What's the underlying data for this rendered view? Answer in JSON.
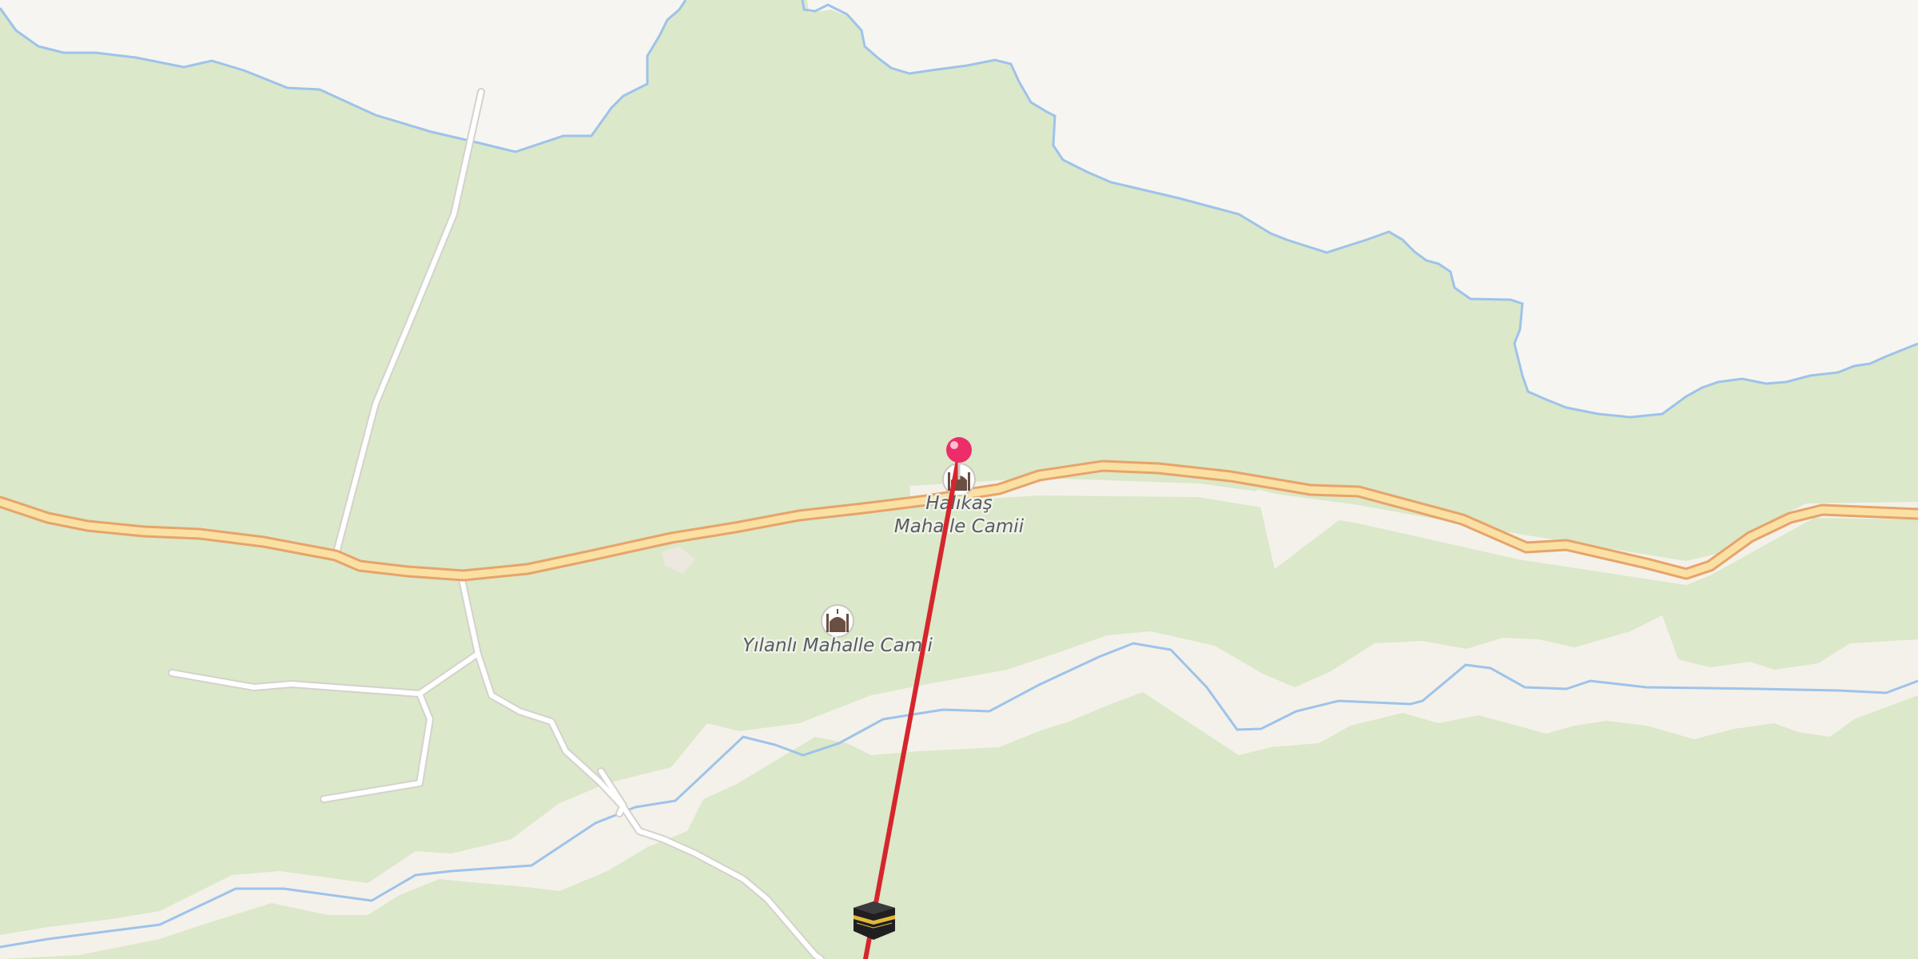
{
  "map": {
    "colors": {
      "land": "#f7f5f1",
      "forest": "#dbe8c9",
      "water_line": "#9ec3ea",
      "main_road_fill": "#fbe0a3",
      "main_road_casing": "#e6a46a",
      "minor_road": "#ffffff",
      "qibla_line": "#d6262d",
      "pin": "#ec2d6a"
    },
    "pois": [
      {
        "id": "halikas",
        "label_line1": "Halıkaş",
        "label_line2": "Mahalle Camii",
        "icon": "mosque-icon"
      },
      {
        "id": "yilanli",
        "label_line1": "Yılanlı Mahalle Camii",
        "icon": "mosque-icon"
      }
    ],
    "markers": {
      "location_pin": "map-pin-icon",
      "qibla_target": "kaaba-icon"
    }
  }
}
